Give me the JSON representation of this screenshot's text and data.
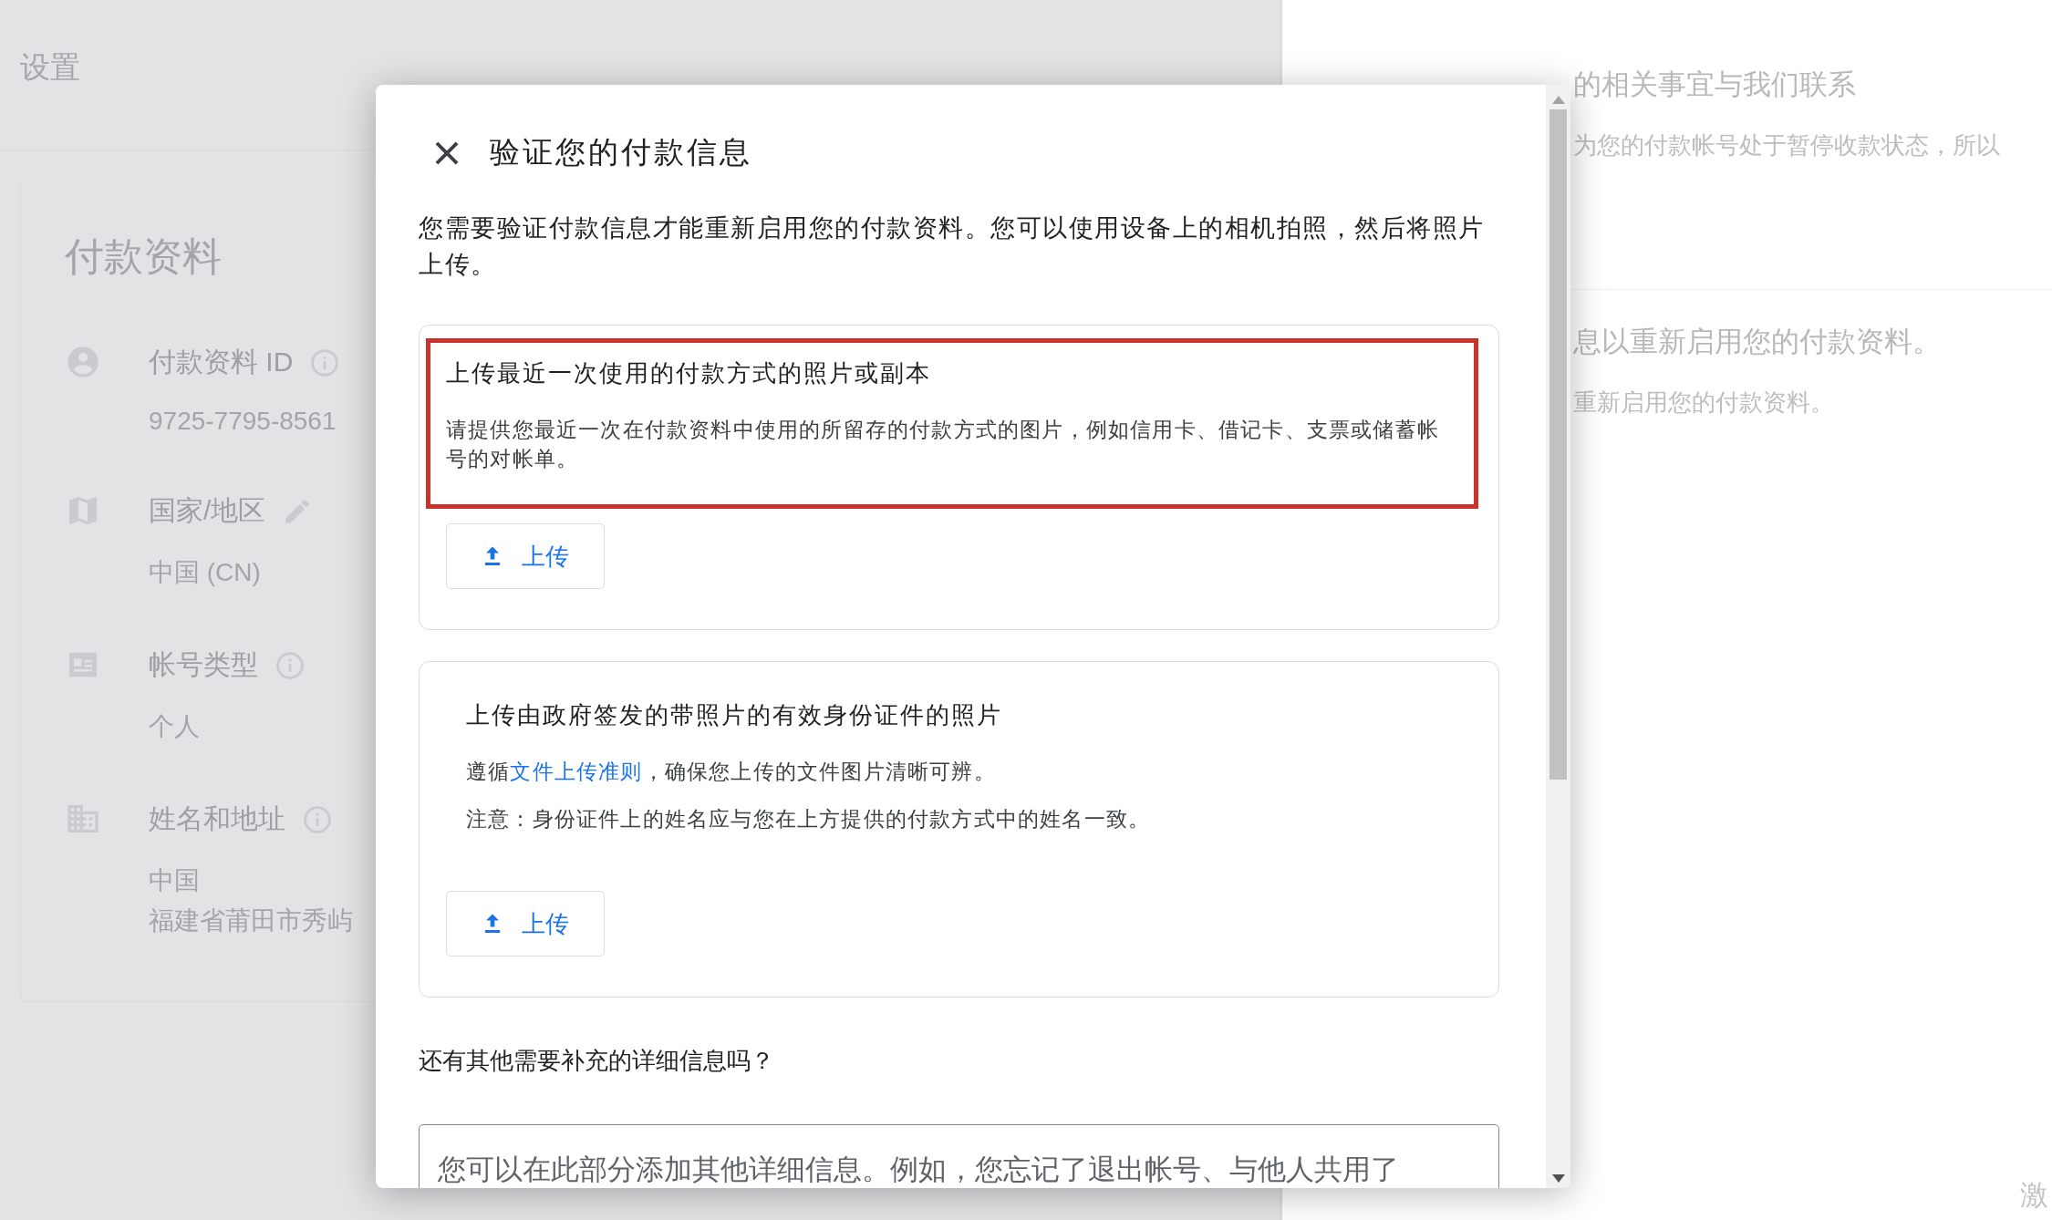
{
  "background": {
    "settings_tab": "设置",
    "card_title": "付款资料",
    "fields": [
      {
        "label": "付款资料 ID",
        "values": [
          "9725-7795-8561"
        ]
      },
      {
        "label": "国家/地区",
        "values": [
          "中国 (CN)"
        ]
      },
      {
        "label": "帐号类型",
        "values": [
          "个人"
        ]
      },
      {
        "label": "姓名和地址",
        "values": [
          "中国",
          "福建省莆田市秀屿"
        ]
      }
    ]
  },
  "right_panel": {
    "lines": [
      {
        "kind": "heading",
        "text": "的相关事宜与我们联系"
      },
      {
        "kind": "body",
        "text": "为您的付款帐号处于暂停收款状态，所以"
      },
      {
        "kind": "divider"
      },
      {
        "kind": "heading",
        "text": "息以重新启用您的付款资料。"
      },
      {
        "kind": "body",
        "text": "重新启用您的付款资料。"
      }
    ],
    "corner_text": "激"
  },
  "dialog": {
    "title": "验证您的付款信息",
    "intro": "您需要验证付款信息才能重新启用您的付款资料。您可以使用设备上的相机拍照，然后将照片上传。",
    "cards": [
      {
        "title": "上传最近一次使用的付款方式的照片或副本",
        "highlighted": true,
        "paragraphs": [
          {
            "text": "请提供您最近一次在付款资料中使用的所留存的付款方式的图片，例如信用卡、借记卡、支票或储蓄帐号的对帐单。"
          }
        ],
        "button": "上传"
      },
      {
        "title": "上传由政府签发的带照片的有效身份证件的照片",
        "highlighted": false,
        "paragraphs": [
          {
            "text": "遵循",
            "link": "文件上传准则",
            "after": "，确保您上传的文件图片清晰可辨。"
          },
          {
            "text": "注意：身份证件上的姓名应与您在上方提供的付款方式中的姓名一致。"
          }
        ],
        "button": "上传"
      }
    ],
    "question": "还有其他需要补充的详细信息吗？",
    "details_field": {
      "placeholder": "您可以在此部分添加其他详细信息。例如，您忘记了退出帐号、与他人共用了"
    }
  }
}
